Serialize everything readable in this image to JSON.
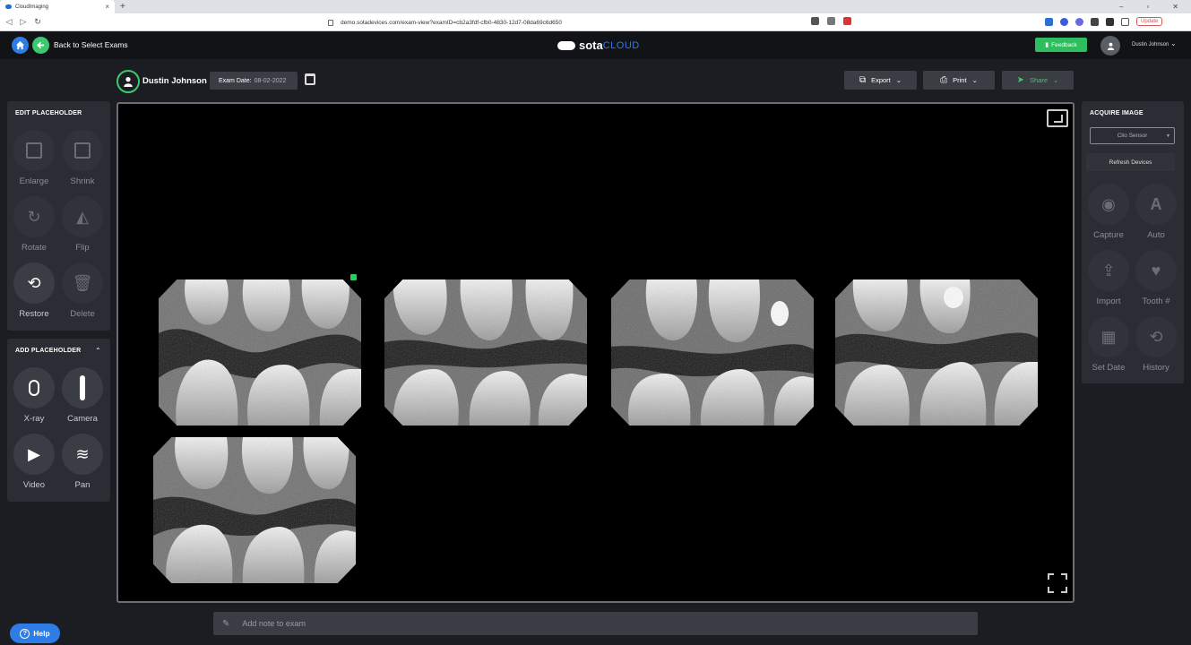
{
  "browser": {
    "tab_title": "CloudImaging",
    "url": "demo.sotadevices.com/exam-view?examID=cb2a3fdf-cfb0-4830-12d7-08da69c6d650",
    "update_label": "Update"
  },
  "header": {
    "back_label": "Back to Select Exams",
    "logo_main": "sota",
    "logo_sub": "CLOUD",
    "feedback_label": "Feedback",
    "user_name": "Dustin Johnson"
  },
  "patient": {
    "name": "Dustin Johnson",
    "exam_date_label": "Exam Date:",
    "exam_date": "08-02-2022"
  },
  "toolbar": {
    "export_label": "Export",
    "print_label": "Print",
    "share_label": "Share"
  },
  "edit_panel": {
    "title": "EDIT PLACEHOLDER",
    "tools": [
      "Enlarge",
      "Shrink",
      "Rotate",
      "Flip",
      "Restore",
      "Delete"
    ]
  },
  "add_panel": {
    "title": "ADD PLACEHOLDER",
    "tools": [
      "X-ray",
      "Camera",
      "Video",
      "Pan"
    ]
  },
  "acquire_panel": {
    "title": "ACQUIRE IMAGE",
    "device": "Clio Sensor",
    "refresh_label": "Refresh Devices",
    "tools": [
      "Capture",
      "Auto",
      "Import",
      "Tooth #",
      "Set Date",
      "History"
    ]
  },
  "note": {
    "placeholder": "Add note to exam"
  },
  "help_label": "Help",
  "icons": {
    "enlarge": "enlarge-icon",
    "shrink": "shrink-icon",
    "rotate": "rotate-icon",
    "flip": "flip-icon",
    "restore": "restore-icon",
    "delete": "trash-icon",
    "xray": "xray-sensor-icon",
    "camera": "intraoral-camera-icon",
    "video": "video-icon",
    "pan": "panoramic-icon",
    "capture": "camera-icon",
    "auto": "auto-icon",
    "import": "import-icon",
    "tooth": "tooth-icon",
    "set_date": "calendar-icon",
    "history": "history-icon"
  },
  "colors": {
    "accent_green": "#3cc86e",
    "accent_blue": "#2e7ce6",
    "panel": "#2a2d33"
  }
}
